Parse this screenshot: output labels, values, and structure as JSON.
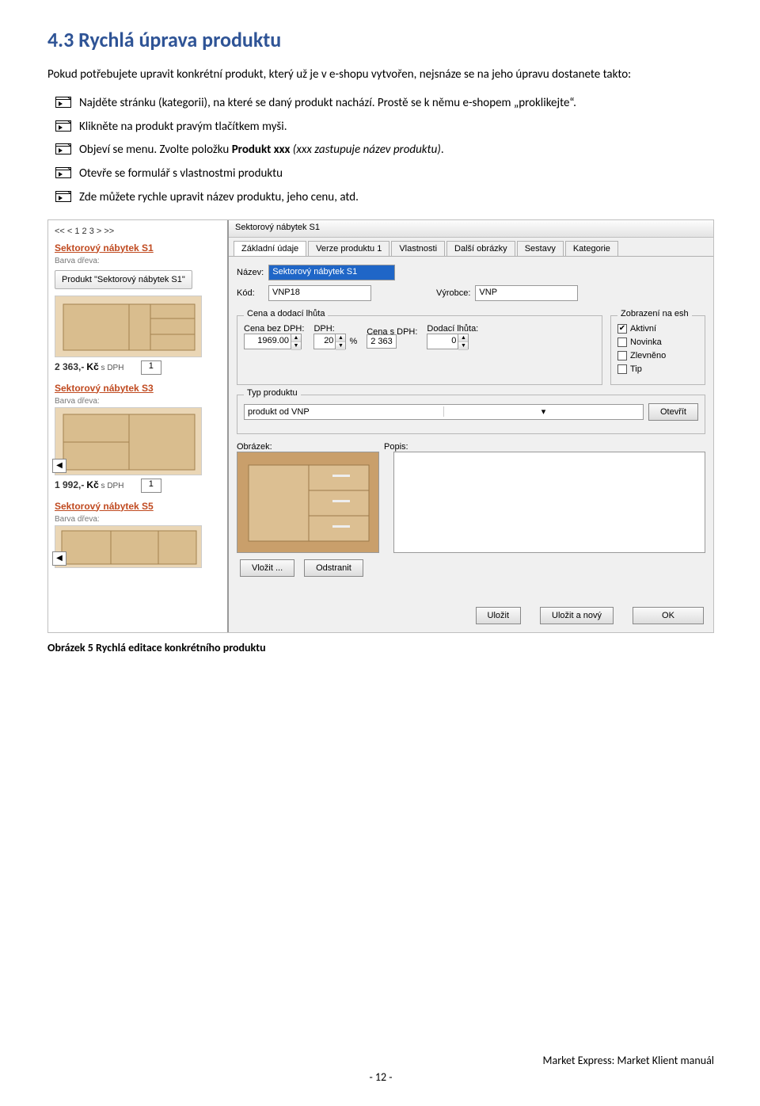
{
  "heading": "4.3  Rychlá úprava produktu",
  "intro": "Pokud potřebujete upravit konkrétní produkt, který už je v e-shopu vytvořen, nejsnáze se na jeho úpravu dostanete takto:",
  "bullets": {
    "b1": "Najděte stránku (kategorii), na které se daný produkt nachází. Prostě se k němu e-shopem „proklikejte“.",
    "b2": "Klikněte na produkt pravým tlačítkem myši.",
    "b3_pre": "Objeví se menu. Zvolte položku ",
    "b3_bold": "Produkt xxx",
    "b3_i": " (xxx zastupuje název produktu)",
    "b3_post": ".",
    "b4": "Otevře se formulář s vlastnostmi produktu",
    "b5": "Zde můžete rychle upravit název produktu, jeho cenu, atd."
  },
  "eshop": {
    "pager": "<< < 1 2 3 > >>",
    "p1_title": "Sektorový nábytek S1",
    "attr_wood": "Barva dřeva:",
    "tooltip": "Produkt \"Sektorový nábytek S1\"",
    "price1_num": "2 363,-",
    "price1_cur": "Kč",
    "price1_tax": " s DPH",
    "qty1": "1",
    "p3_title": "Sektorový nábytek S3",
    "price3_num": "1 992,-",
    "price3_cur": "Kč",
    "price3_tax": " s DPH",
    "qty3": "1",
    "p5_title": "Sektorový nábytek S5"
  },
  "dialog": {
    "title": "Sektorový nábytek S1",
    "tabs": {
      "t0": "Základní údaje",
      "t1": "Verze produktu 1",
      "t2": "Vlastnosti",
      "t3": "Další obrázky",
      "t4": "Sestavy",
      "t5": "Kategorie"
    },
    "labels": {
      "name": "Název:",
      "code": "Kód:",
      "maker": "Výrobce:",
      "g_price": "Cena a dodací lhůta",
      "price_ex": "Cena bez DPH:",
      "vat": "DPH:",
      "price_in": "Cena s DPH:",
      "delivery": "Dodací lhůta:",
      "pct": "%",
      "g_type": "Typ produktu",
      "open": "Otevřít",
      "image": "Obrázek:",
      "desc": "Popis:",
      "insert": "Vložit ...",
      "remove": "Odstranit",
      "save": "Uložit",
      "save_new": "Uložit a nový",
      "ok": "OK",
      "g_flags": "Zobrazení na esh",
      "active": "Aktivní",
      "novelty": "Novinka",
      "discount": "Zlevněno",
      "tip": "Tip"
    },
    "values": {
      "name": "Sektorový nábytek S1",
      "code": "VNP18",
      "maker": "VNP",
      "price_ex": "1969.00",
      "vat": "20",
      "price_in": "2 363",
      "delivery": "0",
      "type": "produkt od VNP"
    }
  },
  "caption": "Obrázek 5 Rychlá editace konkrétního produktu",
  "footer_brand": "Market Express: Market Klient manuál",
  "footer_page": "- 12 -"
}
